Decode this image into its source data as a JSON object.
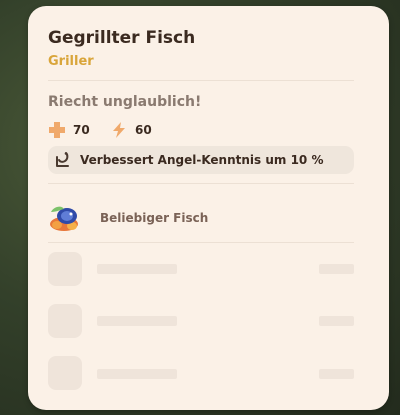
{
  "recipe": {
    "title": "Gegrillter Fisch",
    "station": "Griller",
    "description": "Riecht unglaublich!",
    "stats": [
      {
        "icon": "health-plus-icon",
        "value": "70",
        "color": "#f0a96b"
      },
      {
        "icon": "energy-bolt-icon",
        "value": "60",
        "color": "#f0a96b"
      }
    ],
    "effect": {
      "icon": "fishing-skill-icon",
      "text": "Verbessert Angel-Kenntnis um 10 %"
    },
    "ingredients": [
      {
        "icon": "fish-icon",
        "label": "Beliebiger Fisch"
      }
    ],
    "empty_slots": 3
  },
  "colors": {
    "card_bg": "#fbf1e7",
    "title": "#3b2a20",
    "subtitle": "#d9a53a",
    "muted": "#8a7a70",
    "placeholder": "#efe4da"
  }
}
